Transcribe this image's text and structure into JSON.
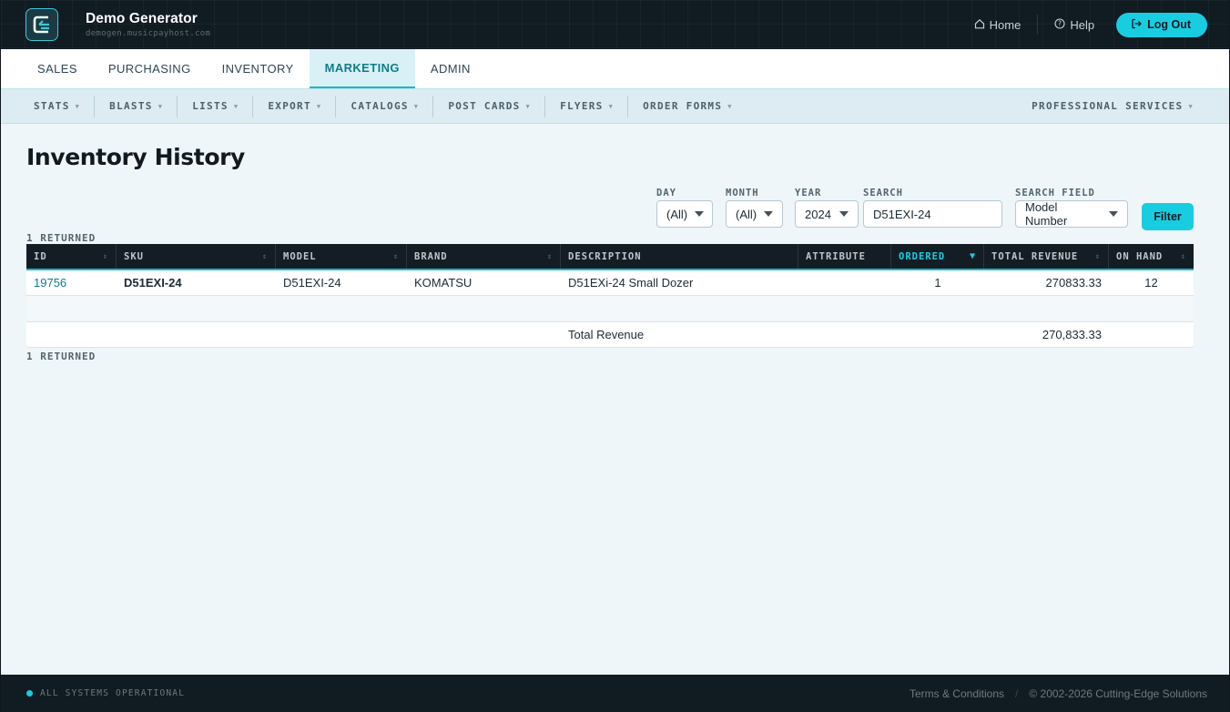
{
  "header": {
    "app_title": "Demo Generator",
    "app_subtitle": "demogen.musicpayhost.com",
    "home_label": "Home",
    "help_label": "Help",
    "logout_label": "Log Out"
  },
  "main_nav": {
    "tabs": [
      {
        "label": "SALES"
      },
      {
        "label": "PURCHASING"
      },
      {
        "label": "INVENTORY"
      },
      {
        "label": "MARKETING",
        "active": true
      },
      {
        "label": "ADMIN"
      }
    ]
  },
  "sub_nav": {
    "items": [
      "STATS",
      "BLASTS",
      "LISTS",
      "EXPORT",
      "CATALOGS",
      "POST CARDS",
      "FLYERS",
      "ORDER FORMS"
    ],
    "right_item": "PROFESSIONAL SERVICES"
  },
  "page": {
    "title": "Inventory History",
    "returned_top": "1 RETURNED",
    "returned_bottom": "1 RETURNED"
  },
  "filters": {
    "day": {
      "label": "DAY",
      "value": "(All)"
    },
    "month": {
      "label": "MONTH",
      "value": "(All)"
    },
    "year": {
      "label": "YEAR",
      "value": "2024"
    },
    "search": {
      "label": "SEARCH",
      "value": "D51EXI-24"
    },
    "search_field": {
      "label": "SEARCH FIELD",
      "value": "Model Number"
    },
    "filter_button": "Filter"
  },
  "table": {
    "columns": {
      "id": "ID",
      "sku": "SKU",
      "model": "MODEL",
      "brand": "BRAND",
      "description": "DESCRIPTION",
      "attribute": "ATTRIBUTE",
      "ordered": "ORDERED",
      "total_revenue": "TOTAL REVENUE",
      "on_hand": "ON HAND"
    },
    "rows": [
      {
        "id": "19756",
        "sku": "D51EXI-24",
        "model": "D51EXI-24",
        "brand": "KOMATSU",
        "description": "D51EXi-24 Small Dozer",
        "attribute": "",
        "ordered": "1",
        "total_revenue": "270833.33",
        "on_hand": "12"
      }
    ],
    "total_label": "Total Revenue",
    "total_value": "270,833.33"
  },
  "footer": {
    "status": "ALL SYSTEMS OPERATIONAL",
    "terms": "Terms & Conditions",
    "slash": "/",
    "copyright": "© 2002-2026 Cutting-Edge Solutions"
  },
  "colors": {
    "accent": "#19cde0",
    "header_bg": "#111b22",
    "page_bg": "#eef6f9",
    "link": "#0f7d8c"
  }
}
